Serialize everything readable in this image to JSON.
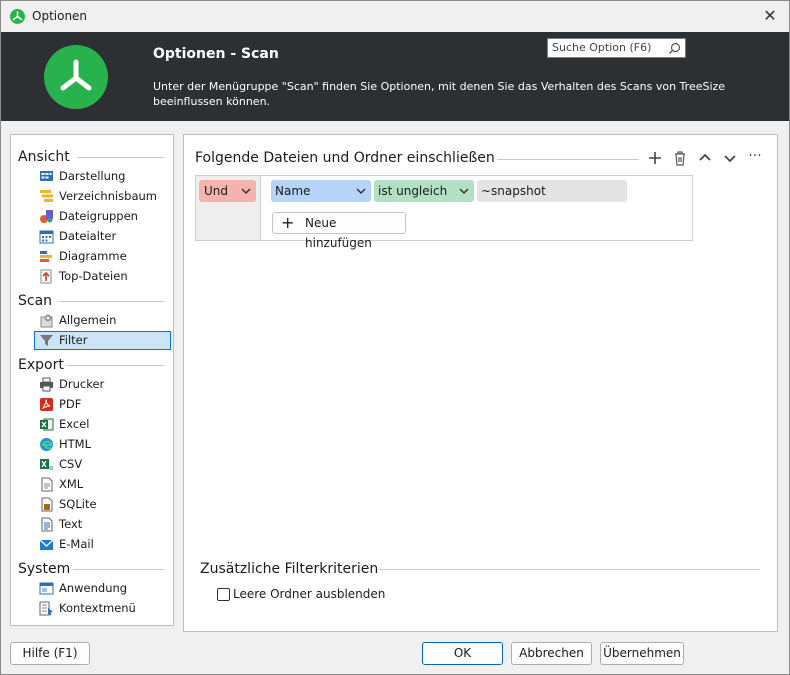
{
  "window": {
    "title": "Optionen",
    "close_glyph": "✕"
  },
  "header": {
    "title": "Optionen - Scan",
    "description": "Unter der Menügruppe \"Scan\" finden Sie Optionen, mit denen Sie das Verhalten des Scans von TreeSize beeinflussen können.",
    "search_placeholder": "Suche Option (F6)"
  },
  "sidebar": {
    "groups": {
      "ansicht": "Ansicht",
      "scan": "Scan",
      "export": "Export",
      "system": "System"
    },
    "items": {
      "darstellung": "Darstellung",
      "verzeichnisbaum": "Verzeichnisbaum",
      "dateigruppen": "Dateigruppen",
      "dateialter": "Dateialter",
      "diagramme": "Diagramme",
      "top_dateien": "Top-Dateien",
      "allgemein": "Allgemein",
      "filter": "Filter",
      "drucker": "Drucker",
      "pdf": "PDF",
      "excel": "Excel",
      "html": "HTML",
      "csv": "CSV",
      "xml": "XML",
      "sqlite": "SQLite",
      "text": "Text",
      "email": "E-Mail",
      "anwendung": "Anwendung",
      "kontextmenu": "Kontextmenü"
    },
    "selected": "filter"
  },
  "main": {
    "section_title": "Folgende Dateien und Ordner einschließen",
    "rule": {
      "operator": "Und",
      "field": "Name",
      "comparison": "ist ungleich",
      "value": "~snapshot"
    },
    "add_button": "Neue hinzufügen",
    "toolbar_more": "···",
    "additional_title": "Zusätzliche Filterkriterien",
    "checkbox_label": "Leere Ordner ausblenden",
    "checkbox_checked": false
  },
  "footer": {
    "help": "Hilfe (F1)",
    "ok": "OK",
    "cancel": "Abbrechen",
    "apply": "Übernehmen"
  },
  "colors": {
    "header_bg": "#2d3033",
    "brand_green": "#28b24d",
    "und_bg": "#f5b3ae",
    "name_bg": "#b6d4f7",
    "comparison_bg": "#b3e0c4",
    "value_bg": "#e4e4e4",
    "selection_bg": "#cce4f7"
  }
}
